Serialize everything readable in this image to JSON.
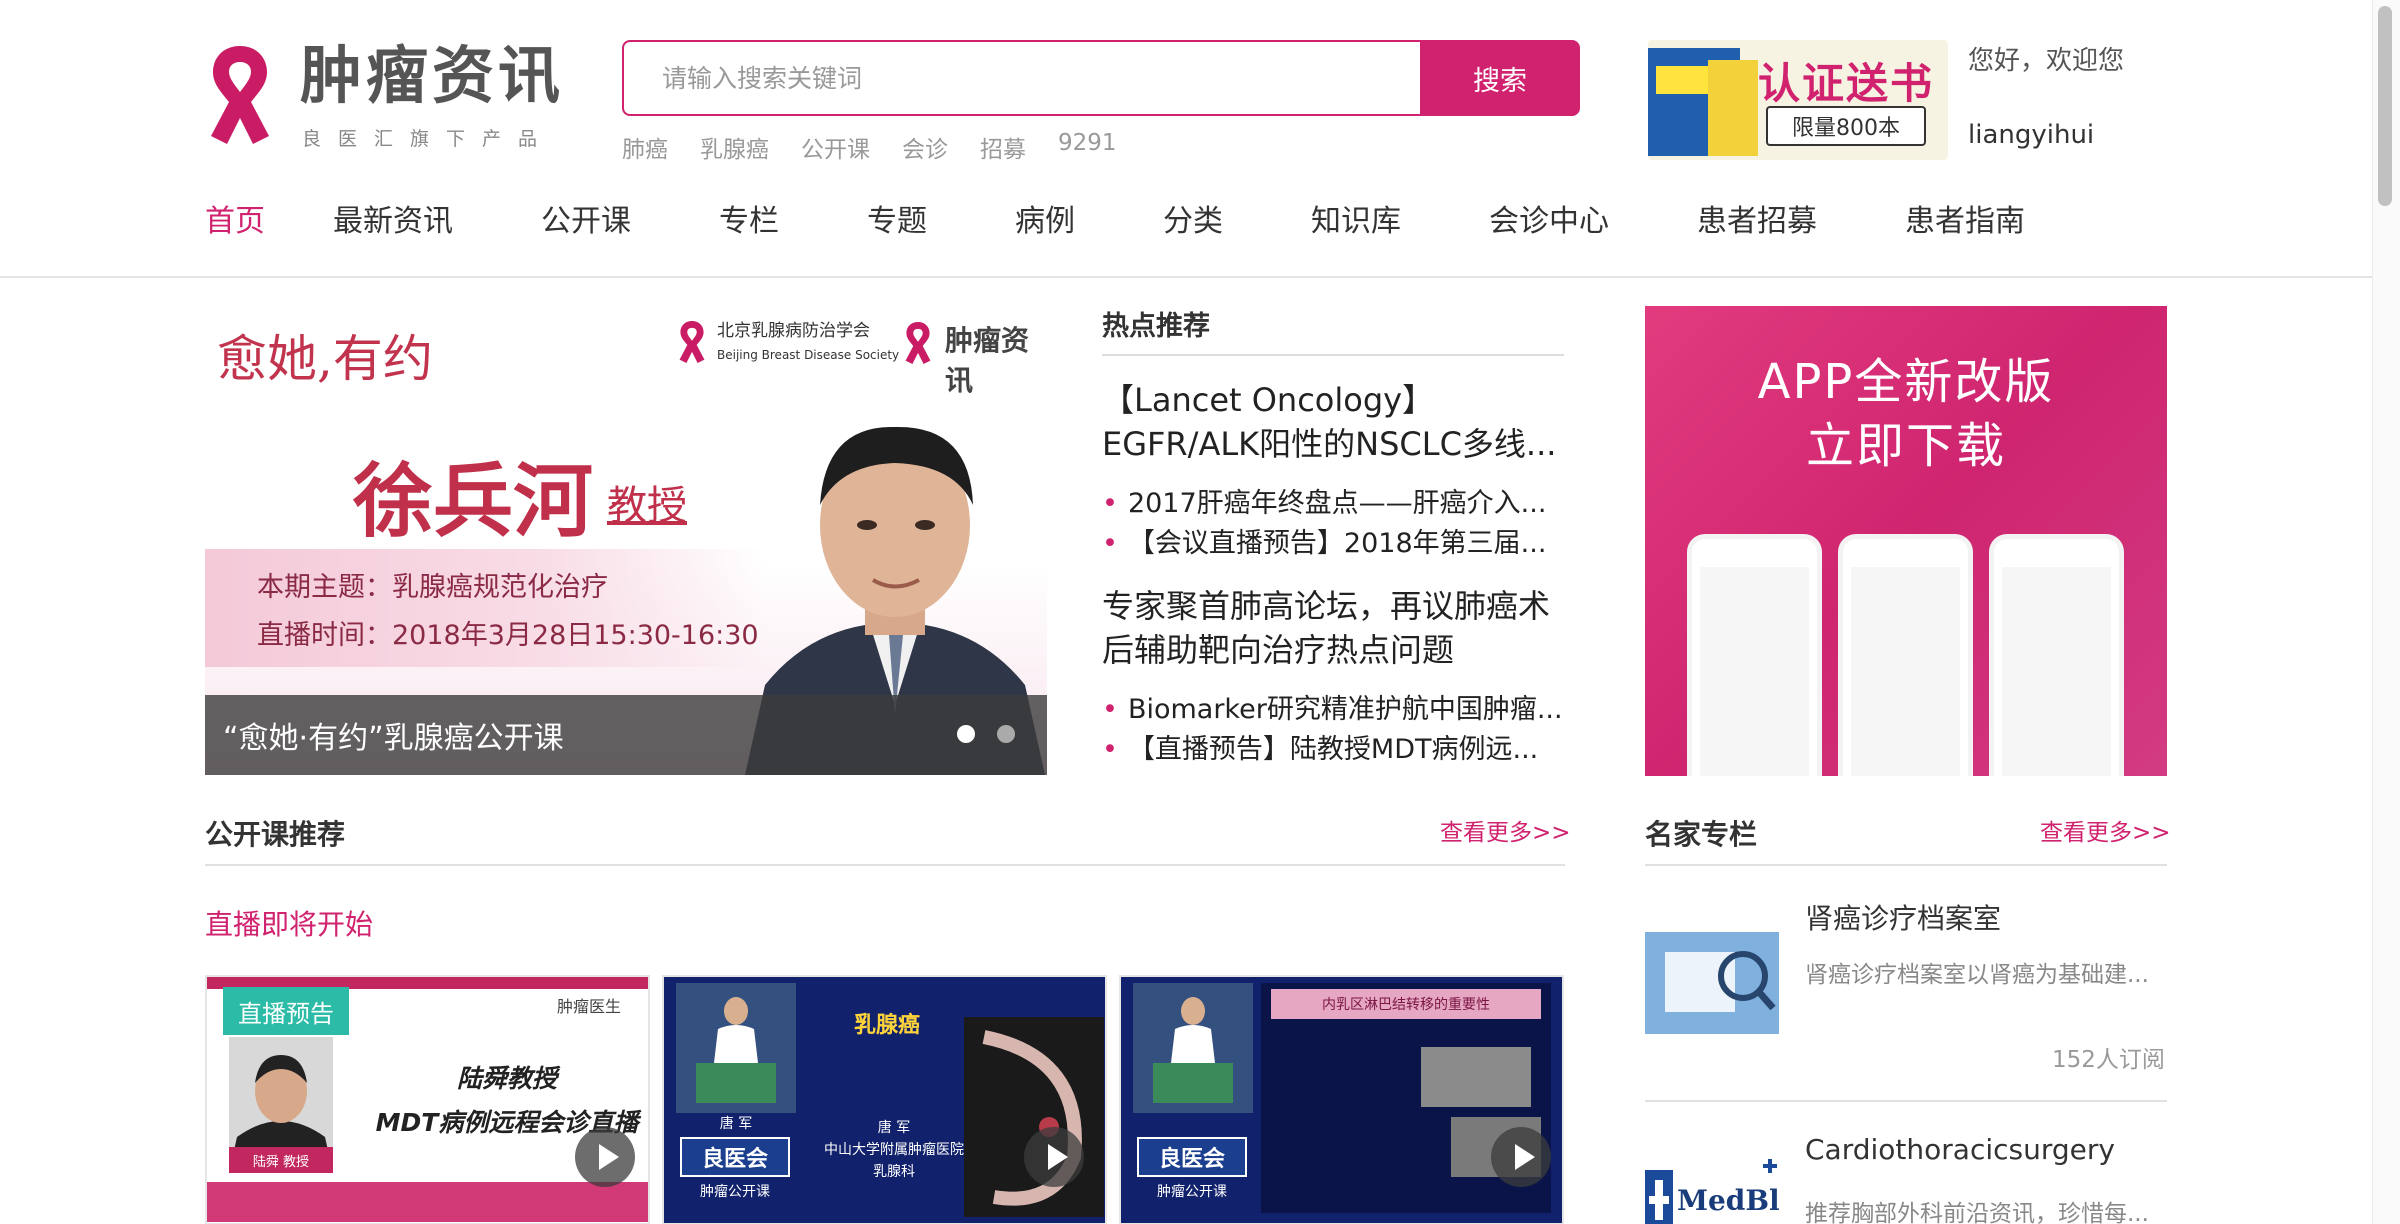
{
  "header": {
    "logo_text": "肿瘤资讯",
    "logo_subtitle": "良医汇旗下产品",
    "search_placeholder": "请输入搜索关键词",
    "search_button": "搜索",
    "hot_words": [
      "肺癌",
      "乳腺癌",
      "公开课",
      "会诊",
      "招募",
      "9291"
    ],
    "promo_title": "认证送书",
    "promo_badge": "限量800本",
    "welcome": "您好，欢迎您",
    "username": "liangyihui"
  },
  "nav": {
    "items": [
      "首页",
      "最新资讯",
      "公开课",
      "专栏",
      "专题",
      "病例",
      "分类",
      "知识库",
      "会诊中心",
      "患者招募",
      "患者指南"
    ],
    "active_index": 0
  },
  "banner": {
    "slogan": "愈她,有约",
    "org_name": "北京乳腺病防治学会",
    "org_name_en": "Beijing Breast Disease Society",
    "org_brand": "肿瘤资讯",
    "speaker": "徐兵河",
    "speaker_title": "教授",
    "topic": "本期主题：乳腺癌规范化治疗",
    "time": "直播时间：2018年3月28日15:30-16:30",
    "caption": "“愈她·有约”乳腺癌公开课"
  },
  "hot": {
    "title": "热点推荐",
    "headline1": "【Lancet Oncology】EGFR/ALK阳性的NSCLC多线...",
    "list1": [
      "2017肝癌年终盘点——肝癌介入...",
      "【会议直播预告】2018年第三届..."
    ],
    "headline2": "专家聚首肺高论坛，再议肺癌术后辅助靶向治疗热点问题",
    "list2": [
      "Biomarker研究精准护航中国肿瘤...",
      "【直播预告】陆教授MDT病例远..."
    ]
  },
  "app_ad": {
    "line1": "APP全新改版",
    "line2": "立即下载"
  },
  "courses": {
    "title": "公开课推荐",
    "more": "查看更多>>",
    "live_soon": "直播即将开始",
    "card1": {
      "badge": "直播预告",
      "brand": "肿瘤医生",
      "line1": "陆舜教授",
      "line2": "MDT病例远程会诊直播",
      "speaker_label": "陆舜 教授"
    },
    "card2": {
      "title": "乳腺癌",
      "doctor": "唐 军",
      "hospital": "中山大学附属肿瘤医院",
      "dept": "乳腺科",
      "logo": "良医会",
      "logo_sub": "肿瘤公开课"
    },
    "card3": {
      "title": "内乳区淋巴结转移的重要性",
      "logo": "良医会",
      "logo_sub": "肿瘤公开课"
    }
  },
  "columns": {
    "title": "名家专栏",
    "more": "查看更多>>",
    "items": [
      {
        "name": "肾癌诊疗档案室",
        "desc": "肾癌诊疗档案室以肾癌为基础建...",
        "subscribers": "152人订阅"
      },
      {
        "name": "Cardiothoracicsurgery",
        "desc": "推荐胸部外科前沿资讯，珍惜每...",
        "subscribers": ""
      }
    ]
  }
}
